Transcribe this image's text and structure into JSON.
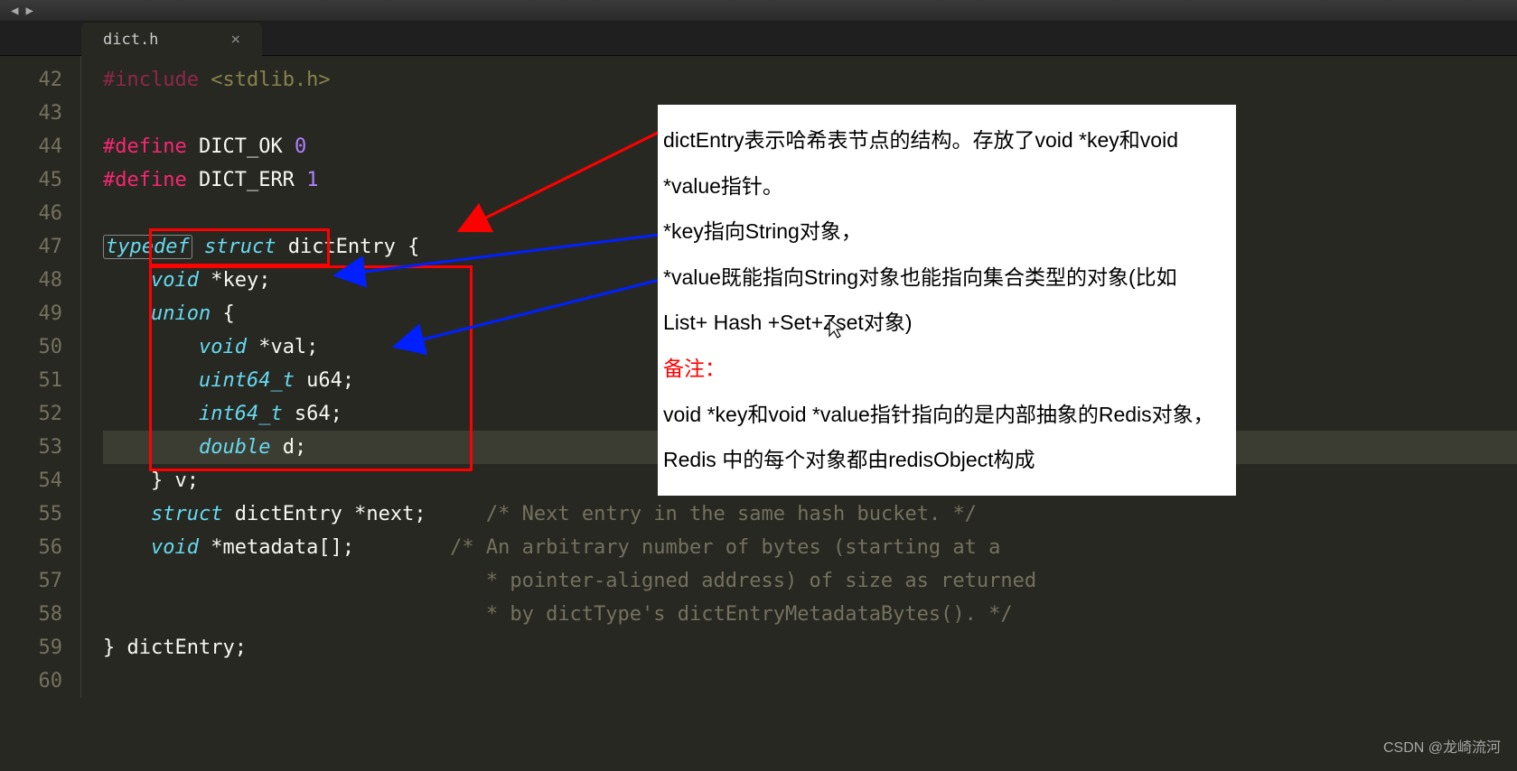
{
  "tab": {
    "filename": "dict.h",
    "close": "×"
  },
  "nav": {
    "back": "◀",
    "forward": "▶"
  },
  "lines": {
    "l42": {
      "num": "42",
      "pre": "#include",
      "arg": "<stdlib.h>"
    },
    "l43": {
      "num": "43"
    },
    "l44": {
      "num": "44",
      "pre": "#define",
      "name": "DICT_OK",
      "val": "0"
    },
    "l45": {
      "num": "45",
      "pre": "#define",
      "name": "DICT_ERR",
      "val": "1"
    },
    "l46": {
      "num": "46"
    },
    "l47": {
      "num": "47",
      "kw1": "typedef",
      "kw2": "struct",
      "name": "dictEntry",
      "brace": " {"
    },
    "l48": {
      "num": "48",
      "indent": "    ",
      "type": "void",
      "rest": " *key;"
    },
    "l49": {
      "num": "49",
      "indent": "    ",
      "kw": "union",
      "brace": " {"
    },
    "l50": {
      "num": "50",
      "indent": "        ",
      "type": "void",
      "rest": " *val;"
    },
    "l51": {
      "num": "51",
      "indent": "        ",
      "type": "uint64_t",
      "rest": " u64;"
    },
    "l52": {
      "num": "52",
      "indent": "        ",
      "type": "int64_t",
      "rest": " s64;"
    },
    "l53": {
      "num": "53",
      "indent": "        ",
      "type": "double",
      "rest": " d;"
    },
    "l54": {
      "num": "54",
      "indent": "    ",
      "text": "} v;"
    },
    "l55": {
      "num": "55",
      "indent": "    ",
      "kw": "struct",
      "name": " dictEntry ",
      "rest": "*next;",
      "comment": "     /* Next entry in the same hash bucket. */"
    },
    "l56": {
      "num": "56",
      "indent": "    ",
      "type": "void",
      "rest": " *metadata[];",
      "comment": "        /* An arbitrary number of bytes (starting at a"
    },
    "l57": {
      "num": "57",
      "comment": "                                * pointer-aligned address) of size as returned"
    },
    "l58": {
      "num": "58",
      "comment": "                                * by dictType's dictEntryMetadataBytes(). */"
    },
    "l59": {
      "num": "59",
      "text": "} dictEntry;"
    },
    "l60": {
      "num": "60"
    }
  },
  "annotation": {
    "p1": "dictEntry表示哈希表节点的结构。存放了void *key和void *value指针。",
    "p2": "*key指向String对象，",
    "p3": "*value既能指向String对象也能指向集合类型的对象(比如 List+ Hash +Set+Zset对象)",
    "note_label": "备注：",
    "p4": "void *key和void *value指针指向的是内部抽象的Redis对象，Redis 中的每个对象都由redisObject构成"
  },
  "watermark": "CSDN @龙崎流河"
}
